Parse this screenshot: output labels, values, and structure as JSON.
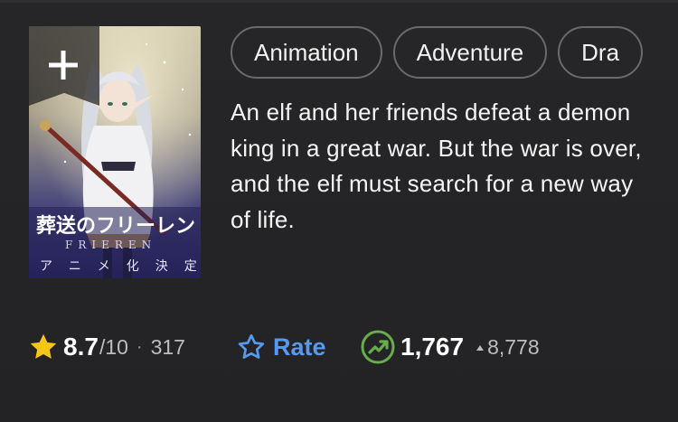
{
  "poster": {
    "add_icon": "plus-icon",
    "title_text": "葬送のフリーレン",
    "title_latin": "FRIEREN",
    "tagline": "アニメ化決定"
  },
  "genres": [
    "Animation",
    "Adventure",
    "Dra"
  ],
  "plot": "An elf and her friends defeat a demon king in a great war. But the war is over, and the elf must search for a new way of life.",
  "rating": {
    "icon": "star-filled-icon",
    "value": "8.7",
    "max": "/10",
    "separator": "·",
    "count": "317"
  },
  "rate": {
    "icon": "star-outline-icon",
    "label": "Rate"
  },
  "popularity": {
    "icon": "trending-up-icon",
    "value": "1,767",
    "delta_icon": "triangle-up-icon",
    "delta": "8,778"
  },
  "colors": {
    "background": "#252527",
    "accent_blue": "#5799ef",
    "star_yellow": "#f5c518",
    "trend_green": "#67ad4b",
    "chip_border": "#6a6a6c"
  }
}
